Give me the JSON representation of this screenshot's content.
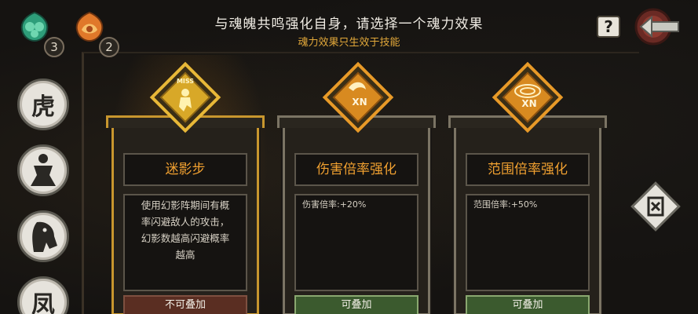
{
  "resources": [
    {
      "icon": "green-soul-gem-icon",
      "count": "3",
      "color": "#2e9e7a"
    },
    {
      "icon": "orange-soul-gem-icon",
      "count": "2",
      "color": "#e0782a"
    }
  ],
  "header": {
    "title": "与魂魄共鸣强化自身，请选择一个魂力效果",
    "subtitle": "魂力效果只生效于技能",
    "help_label": "?"
  },
  "skills_sidebar": [
    {
      "icon": "tiger-medal-icon",
      "glyph": "虎"
    },
    {
      "icon": "figure-medal-icon",
      "glyph": ""
    },
    {
      "icon": "horse-medal-icon",
      "glyph": ""
    },
    {
      "icon": "wind-medal-icon",
      "glyph": "凤"
    }
  ],
  "cards": [
    {
      "name": "迷影步",
      "description_lines": [
        "使用幻影阵期间有概",
        "率闪避敌人的攻击，",
        "幻影数越高闪避概率",
        "越高"
      ],
      "tag": "不可叠加",
      "emblem_label": "MISS",
      "style": "gold"
    },
    {
      "name": "伤害倍率强化",
      "description_lines": [
        "伤害倍率:+20%"
      ],
      "tag": "可叠加",
      "emblem_label": "XN",
      "style": "silver"
    },
    {
      "name": "范围倍率强化",
      "description_lines": [
        "范围倍率:+50%"
      ],
      "tag": "可叠加",
      "emblem_label": "XN",
      "style": "silver"
    }
  ],
  "right_medal": {
    "icon": "wind-medal-diamond-icon"
  }
}
